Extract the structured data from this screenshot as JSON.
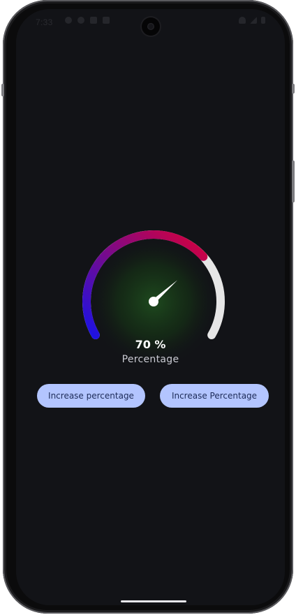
{
  "status_bar": {
    "time": "7:33"
  },
  "gauge": {
    "percent": 70,
    "value_text": "70 %",
    "label": "Percentage",
    "colors": {
      "start": "#1a12e6",
      "mid": "#7a0a8a",
      "end": "#d8003a",
      "track": "#e6e6e6",
      "glow": "#1e4a1e",
      "needle": "#ffffff"
    }
  },
  "buttons": {
    "left_label": "Increase percentage",
    "right_label": "Increase Percentage",
    "color": "#b3c5ff",
    "text_color": "#1d2b57"
  }
}
